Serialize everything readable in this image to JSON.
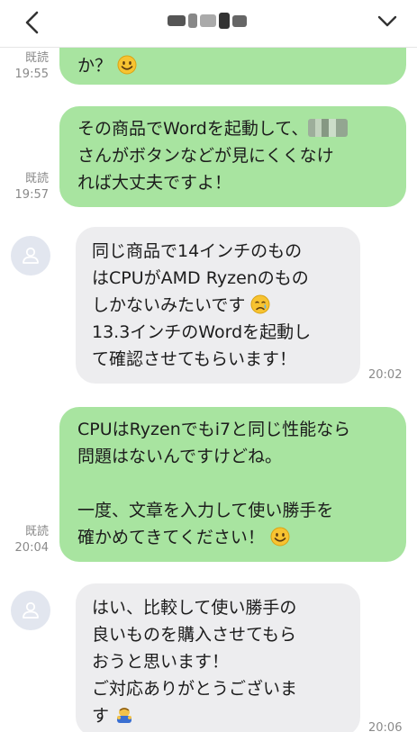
{
  "header": {
    "back_icon": "chevron-left-icon",
    "expand_icon": "chevron-down-icon"
  },
  "messages": [
    {
      "id": "m0",
      "lines": [
        "か？"
      ],
      "emoji": "smile",
      "read": "既読",
      "time": "19:55"
    },
    {
      "id": "m1",
      "lines": [
        "その商品でWordを起動して、",
        "さんがボタンなどが見にくくなけ",
        "れば大丈夫ですよ！"
      ],
      "read": "既読",
      "time": "19:57"
    },
    {
      "id": "m2",
      "lines": [
        "同じ商品で14インチのもの",
        "はCPUがAMD Ryzenのもの",
        "しかないみたいです",
        "13.3インチのWordを起動し",
        "て確認させてもらいます！"
      ],
      "emoji": "cry",
      "time": "20:02"
    },
    {
      "id": "m3",
      "lines": [
        "CPUはRyzenでもi7と同じ性能なら",
        "問題はないんですけどね。",
        "",
        "一度、文章を入力して使い勝手を",
        "確かめてきてください！"
      ],
      "emoji": "smile",
      "read": "既読",
      "time": "20:04"
    },
    {
      "id": "m4",
      "lines": [
        "はい、比較して使い勝手の",
        "良いものを購入させてもら",
        "おうと思います！",
        "ご対応ありがとうございま",
        "す"
      ],
      "emoji": "bow",
      "time": "20:06"
    }
  ],
  "colors": {
    "sent_bubble": "#a8e4a0",
    "received_bubble": "#ededef",
    "avatar_bg": "#e2e6ef",
    "meta_text": "#8a8a8a"
  }
}
